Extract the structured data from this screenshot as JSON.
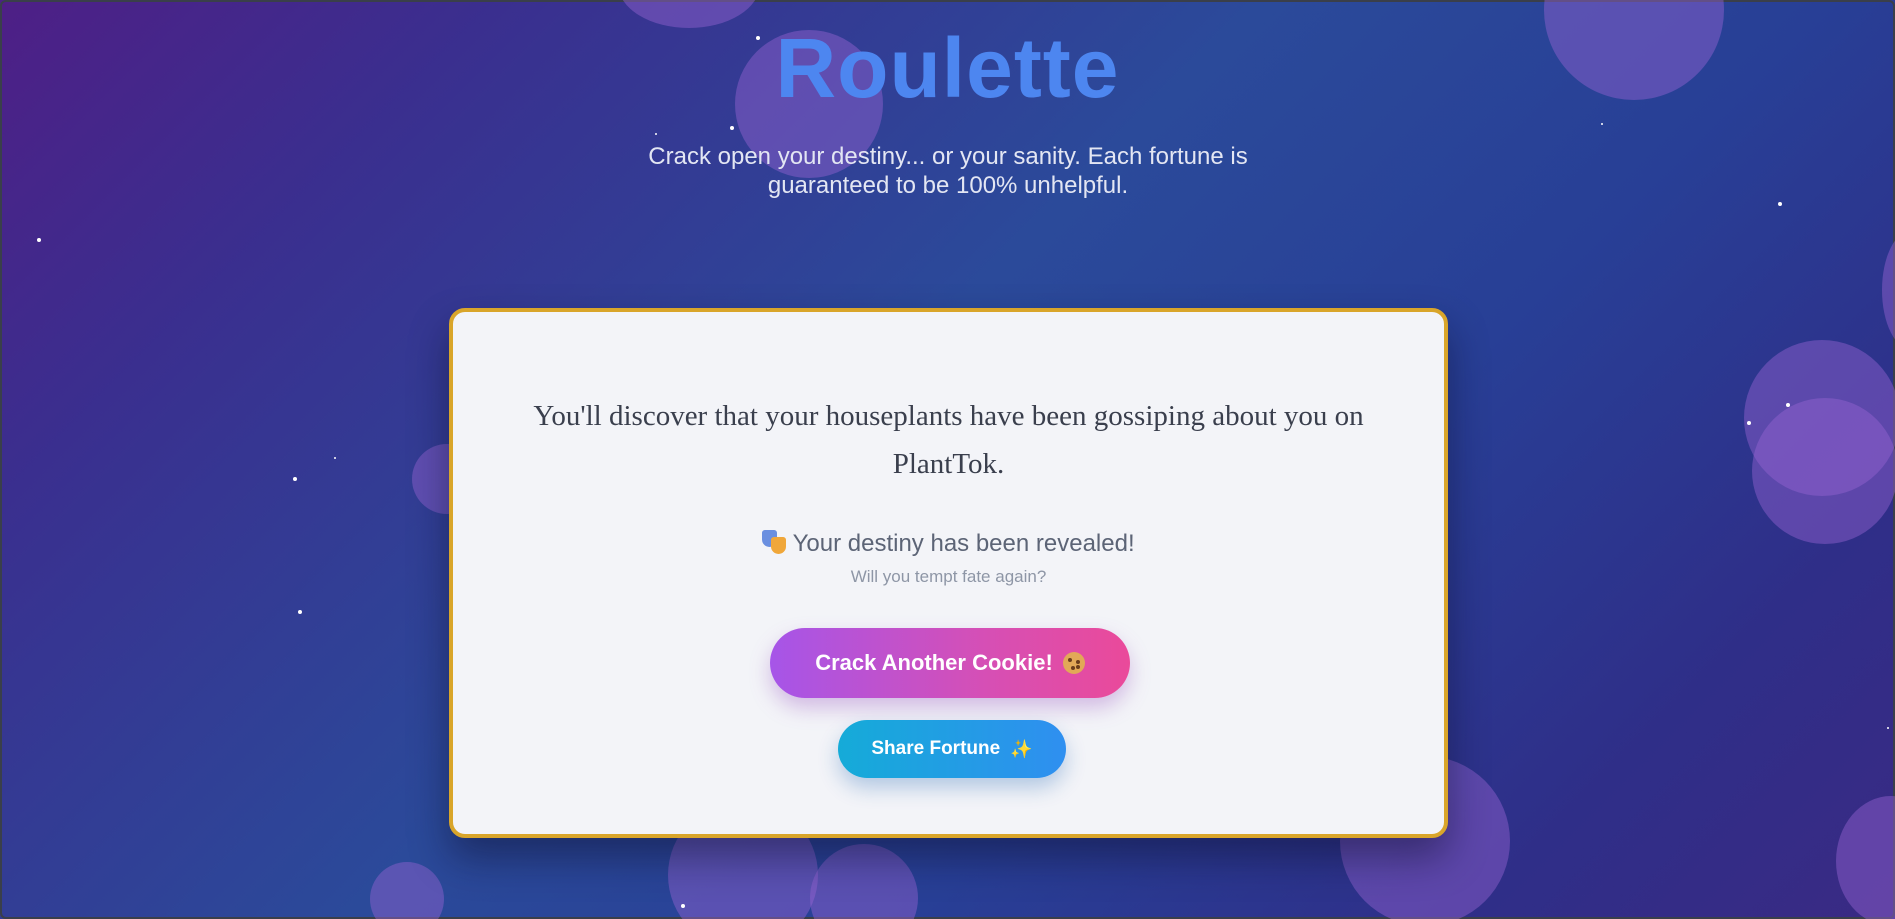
{
  "header": {
    "title": "Roulette",
    "subtitle": "Crack open your destiny... or your sanity. Each fortune is guaranteed to be 100% unhelpful."
  },
  "card": {
    "fortune": "You'll discover that your houseplants have been gossiping about you on PlantTok.",
    "revealed_text": "Your destiny has been revealed!",
    "revealed_icon": "theater-masks-icon",
    "tempt_text": "Will you tempt fate again?",
    "crack_button_label": "Crack Another Cookie!",
    "crack_button_icon": "cookie-icon",
    "share_button_label": "Share Fortune",
    "share_button_icon": "sparkles-icon"
  },
  "colors": {
    "title": "#4d86f0",
    "card_border": "#d9a52a",
    "crack_gradient_start": "#a655e8",
    "crack_gradient_end": "#ea4a9a",
    "share_gradient_start": "#15abd8",
    "share_gradient_end": "#2f8ff0"
  }
}
